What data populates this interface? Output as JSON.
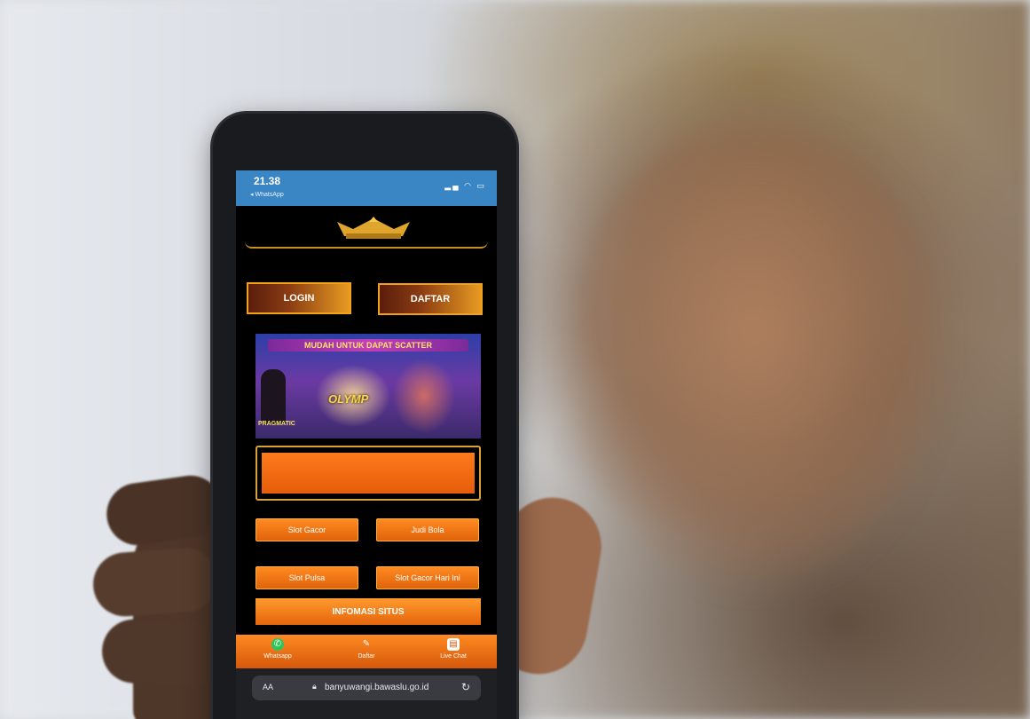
{
  "status_bar": {
    "time": "21.38",
    "back_app": "◂ WhatsApp",
    "icons": [
      "signal-icon",
      "wifi-icon",
      "battery-icon"
    ]
  },
  "site": {
    "logo_alt_icon": "crown-logo-icon",
    "login_label": "LOGIN",
    "daftar_label": "DAFTAR",
    "banner": {
      "title": "MUDAH UNTUK DAPAT SCATTER",
      "brand": "OLYMP",
      "footer": "PRAGMATIC"
    },
    "categories": [
      {
        "label": "Slot Gacor"
      },
      {
        "label": "Judi Bola"
      },
      {
        "label": "Slot Pulsa"
      },
      {
        "label": "Slot Gacor Hari Ini"
      }
    ],
    "info_label": "INFOMASI SITUS"
  },
  "bottom_nav": [
    {
      "label": "Whatsapp",
      "icon": "whatsapp-icon"
    },
    {
      "label": "Daftar",
      "icon": "register-icon"
    },
    {
      "label": "Live Chat",
      "icon": "chat-icon"
    }
  ],
  "browser": {
    "text_size": "AA",
    "url": "banyuwangi.bawaslu.go.id",
    "lock_icon": "lock-icon",
    "reload_icon": "reload-icon"
  },
  "colors": {
    "accent_orange": "#ff8a22",
    "gold": "#c59222",
    "status_blue": "#3a86c4"
  }
}
